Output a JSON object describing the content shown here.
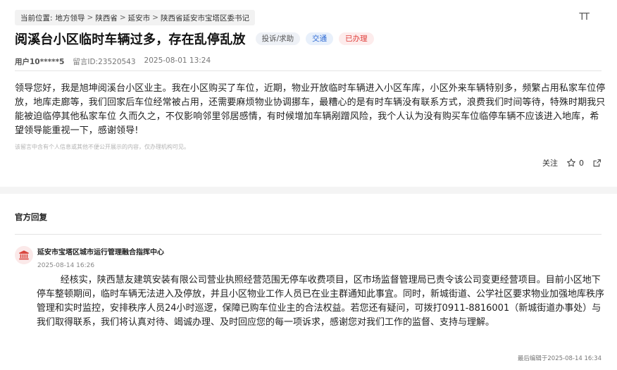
{
  "breadcrumb": {
    "prefix": "当前位置:",
    "items": [
      "地方领导",
      "陕西省",
      "延安市",
      "陕西省延安市宝塔区委书记"
    ],
    "separator": ">"
  },
  "font_toggle_label": "TT",
  "message": {
    "title": "阅溪台小区临时车辆过多，存在乱停乱放",
    "tags": [
      "投诉/求助",
      "交通",
      "已办理"
    ],
    "user": "用户10*****5",
    "message_id": "留言ID:23520543",
    "datetime": "2025-08-01 13:24",
    "body": "领导您好，我是旭坤阅溪台小区业主。我在小区购买了车位，近期，物业开放临时车辆进入小区车库，小区外来车辆特别多，频繁占用私家车位停放，地库走廊等，我们回家后车位经常被占用，还需要麻烦物业协调挪车，最糟心的是有时车辆没有联系方式，浪费我们时间等待，特殊时期我只能被迫临停其他私家车位 久而久之，不仅影响邻里邻居感情，有时候增加车辆剐蹭风险，我个人认为没有购买车位临停车辆不应该进入地库，希望领导能重视一下，感谢领导!",
    "disclaimer": "该留言中含有个人信息或其他不便公开展示的内容，仅办理机构可见。"
  },
  "actions": {
    "follow_label": "关注",
    "like_count": "0"
  },
  "reply": {
    "heading": "官方回复",
    "org_name": "延安市宝塔区城市运行管理融合指挥中心",
    "date": "2025-08-14 16:26",
    "body": "经核实，陕西慧友建筑安装有限公司营业执照经营范围无停车收费项目，区市场监督管理局已责令该公司变更经营项目。目前小区地下停车整顿期间，临时车辆无法进入及停放，并且小区物业工作人员已在业主群通知此事宜。同时，新城街道、公学社区要求物业加强地库秩序管理和实时监控，安排秩序人员24小时巡逻，保障已购车位业主的合法权益。若您还有疑问，可拨打0911-8816001（新城街道办事处）与我们取得联系，我们将认真对待、竭诚办理、及时回应您的每一项诉求，感谢您对我们工作的监督、支持与理解。",
    "last_edited": "最后编辑于2025-08-14 16:34"
  },
  "icons": {
    "like": "star-icon",
    "share": "share-icon",
    "org": "government-building-icon"
  },
  "colors": {
    "tag_blue": "#2f6bd4",
    "tag_red": "#e0403c",
    "org_icon": "#d9473f"
  }
}
